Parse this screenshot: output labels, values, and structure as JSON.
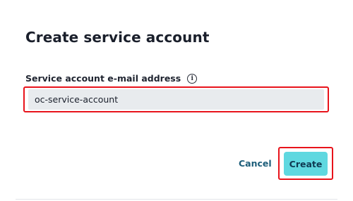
{
  "dialog": {
    "title": "Create service account",
    "field": {
      "label": "Service account e-mail address",
      "info_icon": "info-icon",
      "value": "oc-service-account"
    },
    "actions": {
      "cancel_label": "Cancel",
      "create_label": "Create"
    },
    "colors": {
      "primary_button": "#5fd8e0",
      "link_text": "#1d5e7a",
      "highlight": "#e8131b",
      "input_background": "#e8ebee"
    }
  }
}
